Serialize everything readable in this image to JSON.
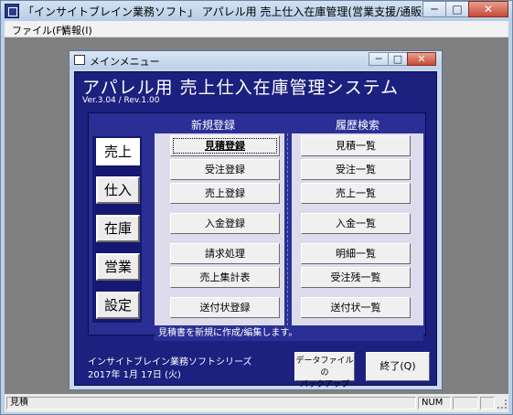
{
  "window": {
    "title": "「インサイトブレイン業務ソフト」 アパレル用 売上仕入在庫管理(営業支援/通販機能付)システム【標",
    "minimize": "─",
    "maximize": "□",
    "close": "✕"
  },
  "menubar": {
    "file": "ファイル(F)",
    "info": "情報(I)"
  },
  "mdi": {
    "title": "メインメニュー",
    "minimize": "─",
    "maximize": "□",
    "close": "✕"
  },
  "app": {
    "title": "アパレル用 売上仕入在庫管理システム",
    "version": "Ver.3.04 / Rev.1.00"
  },
  "sections": {
    "register": "新規登録",
    "search": "履歴検索"
  },
  "categories": [
    {
      "label": "売上",
      "active": true
    },
    {
      "label": "仕入",
      "active": false
    },
    {
      "label": "在庫",
      "active": false
    },
    {
      "label": "営業",
      "active": false
    },
    {
      "label": "設定",
      "active": false
    }
  ],
  "register_buttons": [
    "見積登録",
    "受注登録",
    "売上登録",
    "入金登録",
    "請求処理",
    "売上集計表",
    "送付状登録"
  ],
  "search_buttons": [
    "見積一覧",
    "受注一覧",
    "売上一覧",
    "入金一覧",
    "明細一覧",
    "受注残一覧",
    "送付状一覧"
  ],
  "message": "見積書を新規に作成/編集します。",
  "footer": {
    "series": "インサイトブレイン業務ソフトシリーズ",
    "date": "2017年 1月 17日 (火)",
    "backup_line1": "データファイルの",
    "backup_line2": "バックアップ",
    "exit": "終了(Q)"
  },
  "statusbar": {
    "text": "見積",
    "num": "NUM"
  },
  "colors": {
    "panel_bg": "#1c207e",
    "inner_panel_bg": "#2a2f95",
    "window_chrome": "#bcd0e6"
  }
}
